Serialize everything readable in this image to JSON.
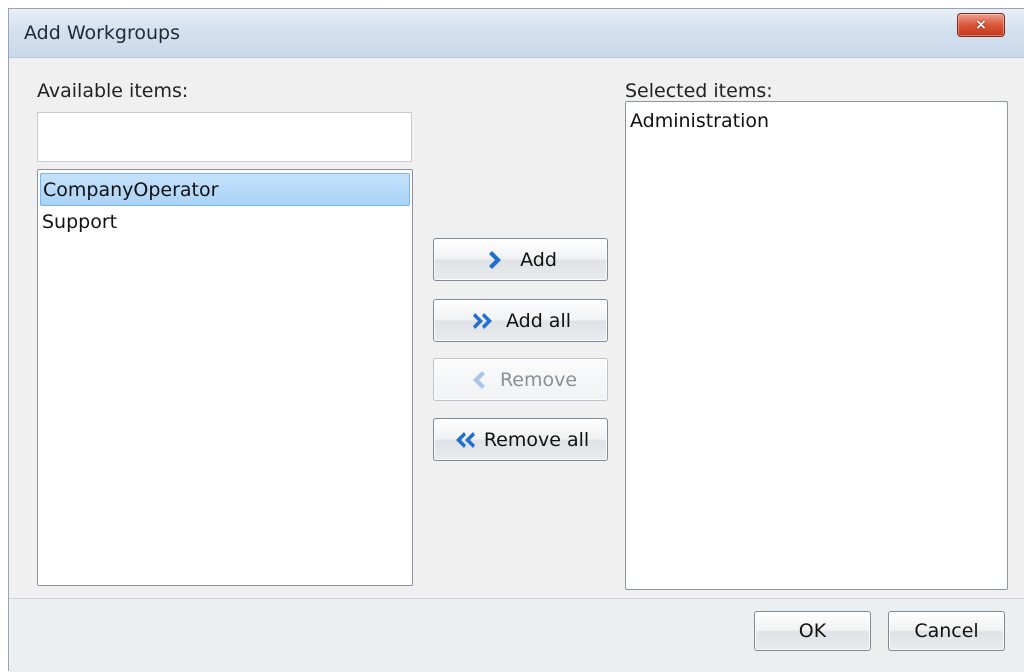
{
  "window": {
    "title": "Add Workgroups",
    "close_label": "×"
  },
  "available": {
    "label": "Available items:",
    "filter_value": "",
    "items": [
      {
        "label": "CompanyOperator",
        "selected": true
      },
      {
        "label": "Support",
        "selected": false
      }
    ]
  },
  "selected": {
    "label": "Selected items:",
    "items": [
      {
        "label": "Administration"
      }
    ]
  },
  "actions": {
    "add": {
      "label": "Add",
      "icon": "chevron-right-icon",
      "enabled": true
    },
    "add_all": {
      "label": "Add all",
      "icon": "double-chevron-right-icon",
      "enabled": true
    },
    "remove": {
      "label": "Remove",
      "icon": "chevron-left-icon",
      "enabled": false
    },
    "remove_all": {
      "label": "Remove all",
      "icon": "double-chevron-left-icon",
      "enabled": true
    }
  },
  "footer": {
    "ok_label": "OK",
    "cancel_label": "Cancel"
  },
  "colors": {
    "accent_icon": "#1f6fd1",
    "selection": "#a9d2f7",
    "close_button": "#d9563a"
  }
}
